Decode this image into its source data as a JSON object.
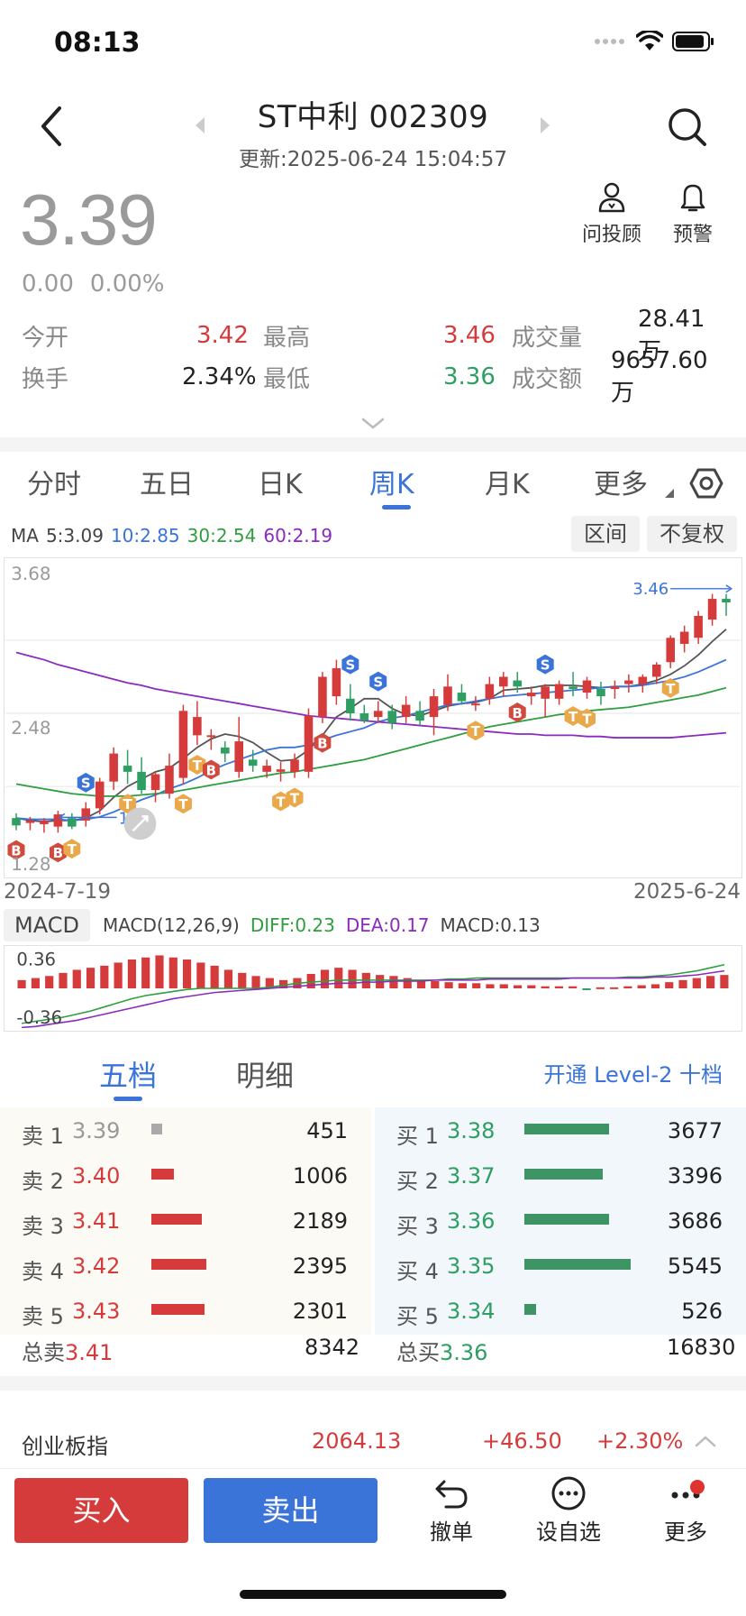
{
  "status_bar": {
    "time": "08:13"
  },
  "header": {
    "title": "ST中利 002309",
    "subtitle": "更新:2025-06-24 15:04:57"
  },
  "price": {
    "last": "3.39",
    "change": "0.00",
    "change_pct": "0.00%"
  },
  "tools": {
    "advisor_label": "问投顾",
    "alert_label": "预警"
  },
  "quote": {
    "open_label": "今开",
    "open": "3.42",
    "high_label": "最高",
    "high": "3.46",
    "volume_label": "成交量",
    "volume": "28.41万",
    "turnover_label": "换手",
    "turnover": "2.34%",
    "low_label": "最低",
    "low": "3.36",
    "amount_label": "成交额",
    "amount": "9657.60万"
  },
  "tabs": [
    "分时",
    "五日",
    "日K",
    "周K",
    "月K",
    "更多"
  ],
  "active_tab": "周K",
  "ma": {
    "prefix": "MA",
    "ma5": "5:3.09",
    "ma10": "10:2.85",
    "ma30": "30:2.54",
    "ma60": "60:2.19"
  },
  "chart_buttons": {
    "range": "区间",
    "adjust": "不复权"
  },
  "chart_labels": {
    "top_price": "3.68",
    "mid_price": "2.48",
    "bottom_price": "1.28",
    "high_marker": "3.46",
    "low_marker": "1.5",
    "date_start": "2024-7-19",
    "date_end": "2025-6-24"
  },
  "macd": {
    "selector": "MACD",
    "params": "MACD(12,26,9)",
    "diff": "DIFF:0.23",
    "dea": "DEA:0.17",
    "value": "MACD:0.13",
    "top": "0.36",
    "bottom": "-0.36"
  },
  "colors": {
    "up": "#d63b3b",
    "down": "#2e9e63",
    "accent": "#3a74d9",
    "ma5": "#555555",
    "ma10": "#3a74d9",
    "ma30": "#2e9e3e",
    "ma60": "#8a2bbd"
  },
  "orderbook": {
    "tab_active": "五档",
    "tab_other": "明细",
    "level2_link": "开通 Level-2 十档",
    "sells": [
      {
        "label": "卖 1",
        "price": "3.39",
        "volume": "451",
        "color": "#999999"
      },
      {
        "label": "卖 2",
        "price": "3.40",
        "volume": "1006",
        "color": "#d63b3b"
      },
      {
        "label": "卖 3",
        "price": "3.41",
        "volume": "2189",
        "color": "#d63b3b"
      },
      {
        "label": "卖 4",
        "price": "3.42",
        "volume": "2395",
        "color": "#d63b3b"
      },
      {
        "label": "卖 5",
        "price": "3.43",
        "volume": "2301",
        "color": "#d63b3b"
      }
    ],
    "buys": [
      {
        "label": "买 1",
        "price": "3.38",
        "volume": "3677"
      },
      {
        "label": "买 2",
        "price": "3.37",
        "volume": "3396"
      },
      {
        "label": "买 3",
        "price": "3.36",
        "volume": "3686"
      },
      {
        "label": "买 4",
        "price": "3.35",
        "volume": "5545"
      },
      {
        "label": "买 5",
        "price": "3.34",
        "volume": "526"
      }
    ],
    "total_sell_label": "总卖",
    "total_sell_price": "3.41",
    "total_sell_volume": "8342",
    "total_buy_label": "总买",
    "total_buy_price": "3.36",
    "total_buy_volume": "16830"
  },
  "index": {
    "name": "创业板指",
    "value": "2064.13",
    "change": "+46.50",
    "change_pct": "+2.30%"
  },
  "actions": {
    "buy": "买入",
    "sell": "卖出",
    "cancel": "撤单",
    "watch": "设自选",
    "more": "更多"
  },
  "candle_markers": [
    "S",
    "T",
    "B"
  ],
  "chart_data": {
    "type": "candlestick",
    "period": "weekly",
    "x_range": [
      "2024-7-19",
      "2025-6-24"
    ],
    "ylim": [
      1.28,
      3.68
    ],
    "y_ticks": [
      3.68,
      2.48,
      1.28
    ],
    "high_marker": 3.46,
    "low_marker": 1.5,
    "candles": [
      {
        "o": 1.62,
        "h": 1.66,
        "l": 1.52,
        "c": 1.56
      },
      {
        "o": 1.58,
        "h": 1.63,
        "l": 1.52,
        "c": 1.6
      },
      {
        "o": 1.57,
        "h": 1.62,
        "l": 1.5,
        "c": 1.6
      },
      {
        "o": 1.55,
        "h": 1.68,
        "l": 1.5,
        "c": 1.65
      },
      {
        "o": 1.62,
        "h": 1.66,
        "l": 1.53,
        "c": 1.55
      },
      {
        "o": 1.6,
        "h": 1.75,
        "l": 1.55,
        "c": 1.7
      },
      {
        "o": 1.7,
        "h": 1.95,
        "l": 1.65,
        "c": 1.92
      },
      {
        "o": 1.92,
        "h": 2.2,
        "l": 1.85,
        "c": 2.15
      },
      {
        "o": 2.05,
        "h": 2.18,
        "l": 1.9,
        "c": 2.0
      },
      {
        "o": 2.0,
        "h": 2.12,
        "l": 1.82,
        "c": 1.85
      },
      {
        "o": 1.85,
        "h": 2.0,
        "l": 1.75,
        "c": 1.98
      },
      {
        "o": 1.82,
        "h": 2.15,
        "l": 1.78,
        "c": 2.05
      },
      {
        "o": 1.95,
        "h": 2.55,
        "l": 1.9,
        "c": 2.5
      },
      {
        "o": 2.3,
        "h": 2.58,
        "l": 2.22,
        "c": 2.45
      },
      {
        "o": 2.3,
        "h": 2.35,
        "l": 2.18,
        "c": 2.3
      },
      {
        "o": 2.2,
        "h": 2.25,
        "l": 2.08,
        "c": 2.15
      },
      {
        "o": 2.0,
        "h": 2.45,
        "l": 1.95,
        "c": 2.25
      },
      {
        "o": 2.1,
        "h": 2.18,
        "l": 2.0,
        "c": 2.05
      },
      {
        "o": 2.0,
        "h": 2.1,
        "l": 1.95,
        "c": 2.05
      },
      {
        "o": 2.0,
        "h": 2.08,
        "l": 1.92,
        "c": 2.02
      },
      {
        "o": 2.0,
        "h": 2.15,
        "l": 1.95,
        "c": 2.1
      },
      {
        "o": 2.0,
        "h": 2.52,
        "l": 1.95,
        "c": 2.46
      },
      {
        "o": 2.45,
        "h": 2.82,
        "l": 2.4,
        "c": 2.78
      },
      {
        "o": 2.62,
        "h": 2.92,
        "l": 2.55,
        "c": 2.85
      },
      {
        "o": 2.6,
        "h": 2.72,
        "l": 2.42,
        "c": 2.48
      },
      {
        "o": 2.48,
        "h": 2.55,
        "l": 2.4,
        "c": 2.42
      },
      {
        "o": 2.45,
        "h": 2.58,
        "l": 2.4,
        "c": 2.5
      },
      {
        "o": 2.5,
        "h": 2.55,
        "l": 2.35,
        "c": 2.4
      },
      {
        "o": 2.45,
        "h": 2.62,
        "l": 2.4,
        "c": 2.55
      },
      {
        "o": 2.5,
        "h": 2.58,
        "l": 2.38,
        "c": 2.42
      },
      {
        "o": 2.45,
        "h": 2.68,
        "l": 2.3,
        "c": 2.62
      },
      {
        "o": 2.55,
        "h": 2.8,
        "l": 2.5,
        "c": 2.7
      },
      {
        "o": 2.65,
        "h": 2.72,
        "l": 2.55,
        "c": 2.58
      },
      {
        "o": 2.55,
        "h": 2.62,
        "l": 2.5,
        "c": 2.56
      },
      {
        "o": 2.6,
        "h": 2.78,
        "l": 2.55,
        "c": 2.72
      },
      {
        "o": 2.7,
        "h": 2.82,
        "l": 2.62,
        "c": 2.78
      },
      {
        "o": 2.75,
        "h": 2.82,
        "l": 2.65,
        "c": 2.7
      },
      {
        "o": 2.62,
        "h": 2.7,
        "l": 2.55,
        "c": 2.65
      },
      {
        "o": 2.6,
        "h": 2.72,
        "l": 2.45,
        "c": 2.7
      },
      {
        "o": 2.6,
        "h": 2.75,
        "l": 2.55,
        "c": 2.72
      },
      {
        "o": 2.7,
        "h": 2.82,
        "l": 2.62,
        "c": 2.68
      },
      {
        "o": 2.65,
        "h": 2.78,
        "l": 2.6,
        "c": 2.75
      },
      {
        "o": 2.68,
        "h": 2.74,
        "l": 2.55,
        "c": 2.62
      },
      {
        "o": 2.68,
        "h": 2.75,
        "l": 2.6,
        "c": 2.7
      },
      {
        "o": 2.72,
        "h": 2.8,
        "l": 2.65,
        "c": 2.75
      },
      {
        "o": 2.72,
        "h": 2.8,
        "l": 2.65,
        "c": 2.78
      },
      {
        "o": 2.78,
        "h": 2.9,
        "l": 2.72,
        "c": 2.88
      },
      {
        "o": 2.9,
        "h": 3.12,
        "l": 2.85,
        "c": 3.1
      },
      {
        "o": 3.05,
        "h": 3.2,
        "l": 2.98,
        "c": 3.15
      },
      {
        "o": 3.1,
        "h": 3.32,
        "l": 3.05,
        "c": 3.28
      },
      {
        "o": 3.25,
        "h": 3.46,
        "l": 3.2,
        "c": 3.42
      },
      {
        "o": 3.42,
        "h": 3.46,
        "l": 3.28,
        "c": 3.39
      }
    ],
    "ma": {
      "ma5": [
        1.62,
        1.6,
        1.59,
        1.6,
        1.6,
        1.62,
        1.68,
        1.79,
        1.88,
        1.94,
        2.0,
        2.03,
        2.11,
        2.2,
        2.27,
        2.31,
        2.29,
        2.24,
        2.16,
        2.09,
        2.1,
        2.18,
        2.3,
        2.45,
        2.52,
        2.6,
        2.6,
        2.52,
        2.47,
        2.46,
        2.5,
        2.54,
        2.56,
        2.57,
        2.6,
        2.67,
        2.68,
        2.69,
        2.71,
        2.71,
        2.71,
        2.7,
        2.69,
        2.7,
        2.7,
        2.72,
        2.75,
        2.8,
        2.87,
        2.96,
        3.07,
        3.17
      ],
      "ma10": [
        1.62,
        1.61,
        1.61,
        1.61,
        1.6,
        1.61,
        1.63,
        1.67,
        1.72,
        1.77,
        1.81,
        1.86,
        1.9,
        1.95,
        2.01,
        2.06,
        2.1,
        2.14,
        2.18,
        2.2,
        2.2,
        2.22,
        2.26,
        2.3,
        2.33,
        2.36,
        2.41,
        2.44,
        2.46,
        2.49,
        2.52,
        2.55,
        2.56,
        2.58,
        2.6,
        2.62,
        2.63,
        2.64,
        2.65,
        2.66,
        2.67,
        2.68,
        2.69,
        2.7,
        2.7,
        2.71,
        2.73,
        2.75,
        2.78,
        2.82,
        2.87,
        2.92
      ],
      "ma30": [
        1.9,
        1.88,
        1.86,
        1.84,
        1.82,
        1.81,
        1.8,
        1.8,
        1.8,
        1.81,
        1.82,
        1.83,
        1.85,
        1.87,
        1.89,
        1.91,
        1.93,
        1.95,
        1.97,
        1.99,
        2.0,
        2.02,
        2.04,
        2.06,
        2.08,
        2.1,
        2.13,
        2.16,
        2.19,
        2.22,
        2.25,
        2.28,
        2.31,
        2.34,
        2.37,
        2.39,
        2.41,
        2.43,
        2.45,
        2.47,
        2.48,
        2.5,
        2.51,
        2.52,
        2.53,
        2.55,
        2.57,
        2.59,
        2.61,
        2.63,
        2.66,
        2.69
      ],
      "ma60": [
        2.98,
        2.95,
        2.92,
        2.88,
        2.85,
        2.82,
        2.79,
        2.76,
        2.73,
        2.71,
        2.68,
        2.66,
        2.64,
        2.62,
        2.6,
        2.58,
        2.56,
        2.54,
        2.52,
        2.5,
        2.48,
        2.46,
        2.45,
        2.44,
        2.43,
        2.42,
        2.41,
        2.4,
        2.39,
        2.38,
        2.37,
        2.36,
        2.35,
        2.34,
        2.33,
        2.32,
        2.31,
        2.31,
        2.3,
        2.3,
        2.3,
        2.29,
        2.29,
        2.28,
        2.28,
        2.28,
        2.28,
        2.28,
        2.29,
        2.3,
        2.31,
        2.32
      ]
    },
    "signals": [
      {
        "i": 0,
        "type": "B",
        "side": "below"
      },
      {
        "i": 3,
        "type": "B",
        "side": "below"
      },
      {
        "i": 4,
        "type": "T",
        "side": "below"
      },
      {
        "i": 5,
        "type": "S",
        "side": "above"
      },
      {
        "i": 8,
        "type": "T",
        "side": "below"
      },
      {
        "i": 12,
        "type": "T",
        "side": "below"
      },
      {
        "i": 13,
        "type": "T",
        "side": "below"
      },
      {
        "i": 14,
        "type": "B",
        "side": "below"
      },
      {
        "i": 19,
        "type": "T",
        "side": "below"
      },
      {
        "i": 20,
        "type": "T",
        "side": "below"
      },
      {
        "i": 22,
        "type": "B",
        "side": "below"
      },
      {
        "i": 24,
        "type": "S",
        "side": "above"
      },
      {
        "i": 26,
        "type": "S",
        "side": "above"
      },
      {
        "i": 33,
        "type": "T",
        "side": "below"
      },
      {
        "i": 36,
        "type": "B",
        "side": "below"
      },
      {
        "i": 38,
        "type": "S",
        "side": "above"
      },
      {
        "i": 40,
        "type": "T",
        "side": "below"
      },
      {
        "i": 41,
        "type": "T",
        "side": "below"
      },
      {
        "i": 47,
        "type": "T",
        "side": "below"
      }
    ],
    "macd_hist": [
      0.08,
      0.1,
      0.12,
      0.15,
      0.18,
      0.2,
      0.22,
      0.25,
      0.28,
      0.3,
      0.32,
      0.3,
      0.28,
      0.25,
      0.22,
      0.18,
      0.15,
      0.12,
      0.1,
      0.08,
      0.1,
      0.14,
      0.18,
      0.2,
      0.18,
      0.15,
      0.13,
      0.12,
      0.1,
      0.08,
      0.07,
      0.06,
      0.05,
      0.05,
      0.04,
      0.04,
      0.03,
      0.03,
      0.02,
      0.02,
      0.02,
      -0.01,
      0.01,
      0.01,
      0.02,
      0.03,
      0.04,
      0.06,
      0.08,
      0.1,
      0.12,
      0.13
    ],
    "diff": [
      -0.34,
      -0.32,
      -0.3,
      -0.28,
      -0.25,
      -0.22,
      -0.18,
      -0.14,
      -0.1,
      -0.07,
      -0.05,
      -0.03,
      -0.01,
      0.0,
      0.0,
      0.0,
      0.0,
      0.0,
      0.01,
      0.03,
      0.05,
      0.06,
      0.07,
      0.08,
      0.08,
      0.08,
      0.08,
      0.08,
      0.08,
      0.08,
      0.08,
      0.09,
      0.09,
      0.1,
      0.1,
      0.1,
      0.1,
      0.1,
      0.1,
      0.1,
      0.1,
      0.1,
      0.1,
      0.1,
      0.11,
      0.11,
      0.12,
      0.13,
      0.15,
      0.17,
      0.2,
      0.23
    ],
    "dea": [
      -0.38,
      -0.37,
      -0.35,
      -0.33,
      -0.31,
      -0.28,
      -0.25,
      -0.22,
      -0.19,
      -0.16,
      -0.13,
      -0.1,
      -0.08,
      -0.06,
      -0.04,
      -0.03,
      -0.02,
      -0.01,
      0.0,
      0.01,
      0.02,
      0.03,
      0.04,
      0.05,
      0.05,
      0.06,
      0.06,
      0.07,
      0.07,
      0.07,
      0.08,
      0.08,
      0.08,
      0.08,
      0.09,
      0.09,
      0.09,
      0.09,
      0.09,
      0.09,
      0.1,
      0.1,
      0.1,
      0.1,
      0.1,
      0.1,
      0.11,
      0.11,
      0.12,
      0.13,
      0.15,
      0.17
    ],
    "macd_range": [
      -0.36,
      0.36
    ]
  }
}
